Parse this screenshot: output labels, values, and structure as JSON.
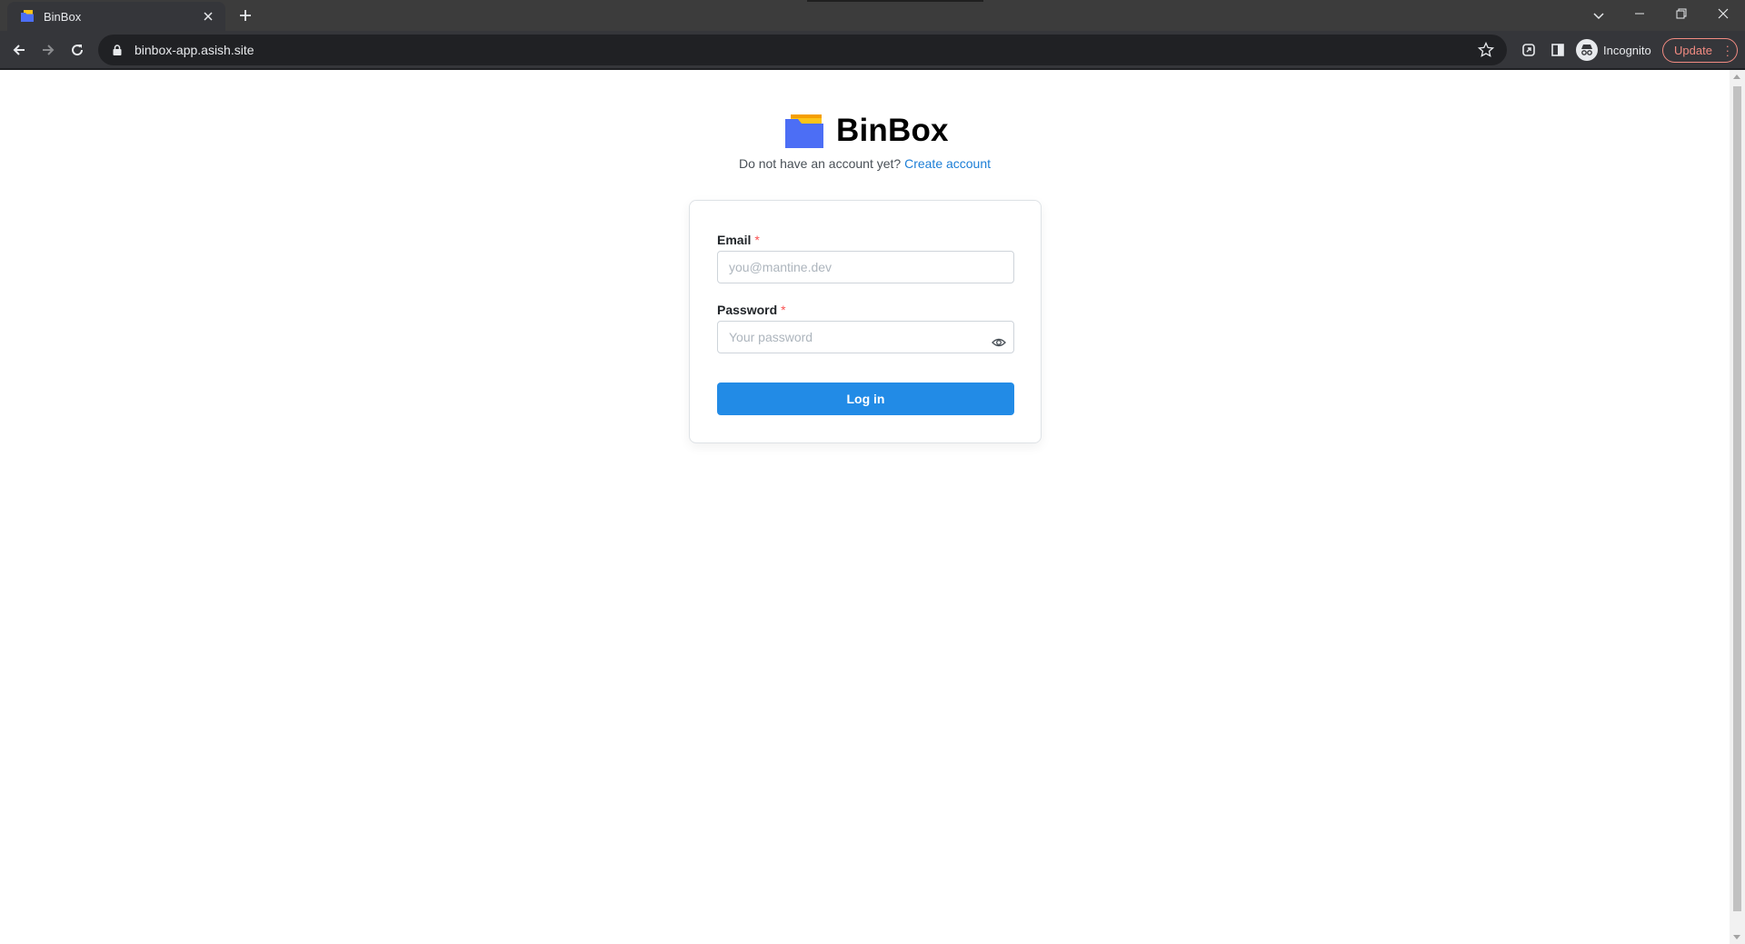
{
  "browser": {
    "tab_title": "BinBox",
    "url": "binbox-app.asish.site",
    "profile_label": "Incognito",
    "update_label": "Update",
    "icons": [
      "back-icon",
      "forward-icon",
      "reload-icon",
      "lock-icon",
      "star-icon",
      "extensions-icon",
      "side-panel-icon",
      "incognito-icon",
      "more-icon"
    ]
  },
  "page": {
    "brand_name": "BinBox",
    "signup_prompt": "Do not have an account yet?",
    "signup_link": "Create account",
    "form": {
      "email_label": "Email",
      "email_required": "*",
      "email_placeholder": "you@mantine.dev",
      "email_value": "",
      "password_label": "Password",
      "password_required": "*",
      "password_placeholder": "Your password",
      "password_value": "",
      "submit_label": "Log in"
    }
  },
  "colors": {
    "accent": "#228be6",
    "link": "#1c7ed6",
    "required": "#fa5252",
    "logo_folder": "#4c6ef5",
    "logo_paper": "#fcc419"
  }
}
